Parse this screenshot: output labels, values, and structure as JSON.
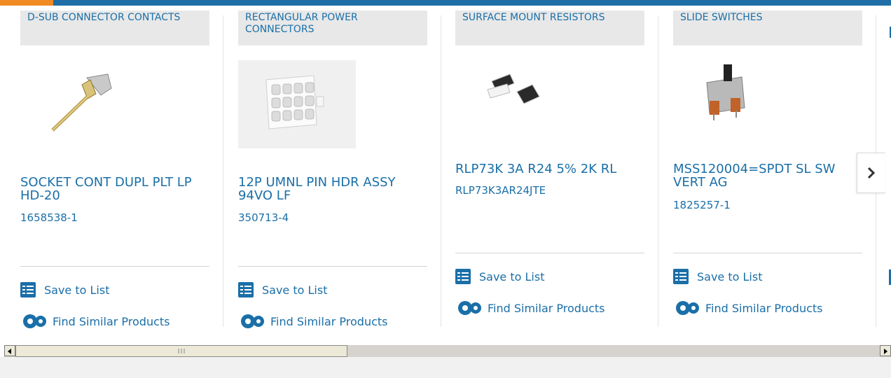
{
  "products": [
    {
      "category": "D-SUB CONNECTOR CONTACTS",
      "name": "SOCKET CONT DUPL PLT LP HD-20",
      "part_number": "1658538-1",
      "image": "socket-contact-image"
    },
    {
      "category": "RECTANGULAR POWER CONNECTORS",
      "name": "12P UMNL PIN HDR ASSY 94VO LF",
      "part_number": "350713-4",
      "image": "pin-header-image"
    },
    {
      "category": "SURFACE MOUNT RESISTORS",
      "name": "RLP73K 3A R24 5% 2K RL",
      "part_number": "RLP73K3AR24JTE",
      "image": "smd-resistor-image"
    },
    {
      "category": "SLIDE SWITCHES",
      "name": "MSS120004=SPDT SL SW VERT AG",
      "part_number": "1825257-1",
      "image": "slide-switch-image"
    }
  ],
  "actions": {
    "save_label": "Save to List",
    "similar_label": "Find Similar Products"
  },
  "icons": {
    "save": "checklist-icon",
    "similar": "gears-icon",
    "next": "chevron-right-icon"
  },
  "colors": {
    "link": "#1a6fa8",
    "header_bar": "#1f6fa6",
    "accent": "#f08a22",
    "category_bg": "#e8e8e8"
  }
}
